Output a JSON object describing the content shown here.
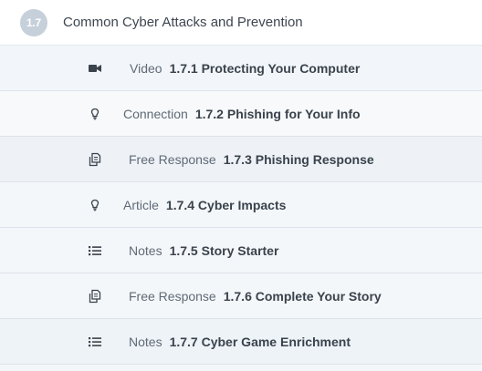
{
  "section": {
    "number": "1.7",
    "title": "Common Cyber Attacks and Prevention"
  },
  "items": [
    {
      "type": "Video",
      "title": "1.7.1 Protecting Your Computer",
      "icon": "video-camera-icon"
    },
    {
      "type": "Connection",
      "title": "1.7.2 Phishing for Your Info",
      "icon": "lightbulb-icon"
    },
    {
      "type": "Free Response",
      "title": "1.7.3 Phishing Response",
      "icon": "copy-pages-icon"
    },
    {
      "type": "Article",
      "title": "1.7.4 Cyber Impacts",
      "icon": "lightbulb-icon"
    },
    {
      "type": "Notes",
      "title": "1.7.5 Story Starter",
      "icon": "list-icon"
    },
    {
      "type": "Free Response",
      "title": "1.7.6 Complete Your Story",
      "icon": "copy-pages-icon"
    },
    {
      "type": "Notes",
      "title": "1.7.7 Cyber Game Enrichment",
      "icon": "list-icon"
    }
  ],
  "colors": {
    "badge": "#c6d0da",
    "title_text": "#3a434c",
    "type_text": "#5f6a75",
    "row_background": "#f4f7fa"
  }
}
